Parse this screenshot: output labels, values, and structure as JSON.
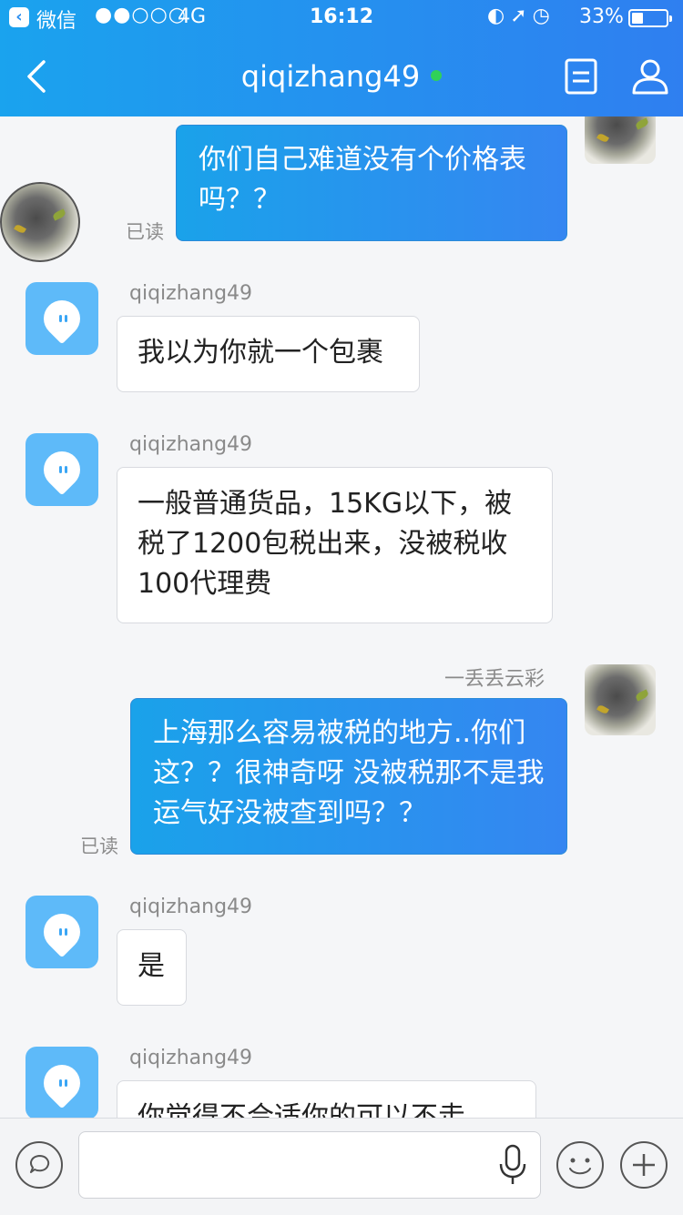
{
  "status_bar": {
    "app": "微信",
    "signal": "●●○○○",
    "network": "4G",
    "time": "16:12",
    "icons": "◐➚◷",
    "battery": "33%"
  },
  "header": {
    "title": "qiqizhang49",
    "online_color": "#30d158"
  },
  "messages": [
    {
      "side": "out",
      "text": "你们自己难道没有个价格表吗？？",
      "read": "已读"
    },
    {
      "side": "in",
      "sender": "qiqizhang49",
      "text": "我以为你就一个包裹"
    },
    {
      "side": "in",
      "sender": "qiqizhang49",
      "text": "一般普通货品，15KG以下，被税了1200包税出来，没被税收100代理费"
    },
    {
      "side": "out",
      "sender": "一丢丢云彩",
      "text": "上海那么容易被税的地方..你们这？？很神奇呀  没被税那不是我运气好没被查到吗？？",
      "read": "已读"
    },
    {
      "side": "in",
      "sender": "qiqizhang49",
      "text": "是"
    },
    {
      "side": "in",
      "sender": "qiqizhang49",
      "text": "你觉得不合适你的可以不走"
    }
  ],
  "input_bar": {
    "placeholder": "",
    "icons": [
      "chat-bubble-icon",
      "microphone-icon",
      "emoji-icon",
      "plus-icon"
    ]
  }
}
